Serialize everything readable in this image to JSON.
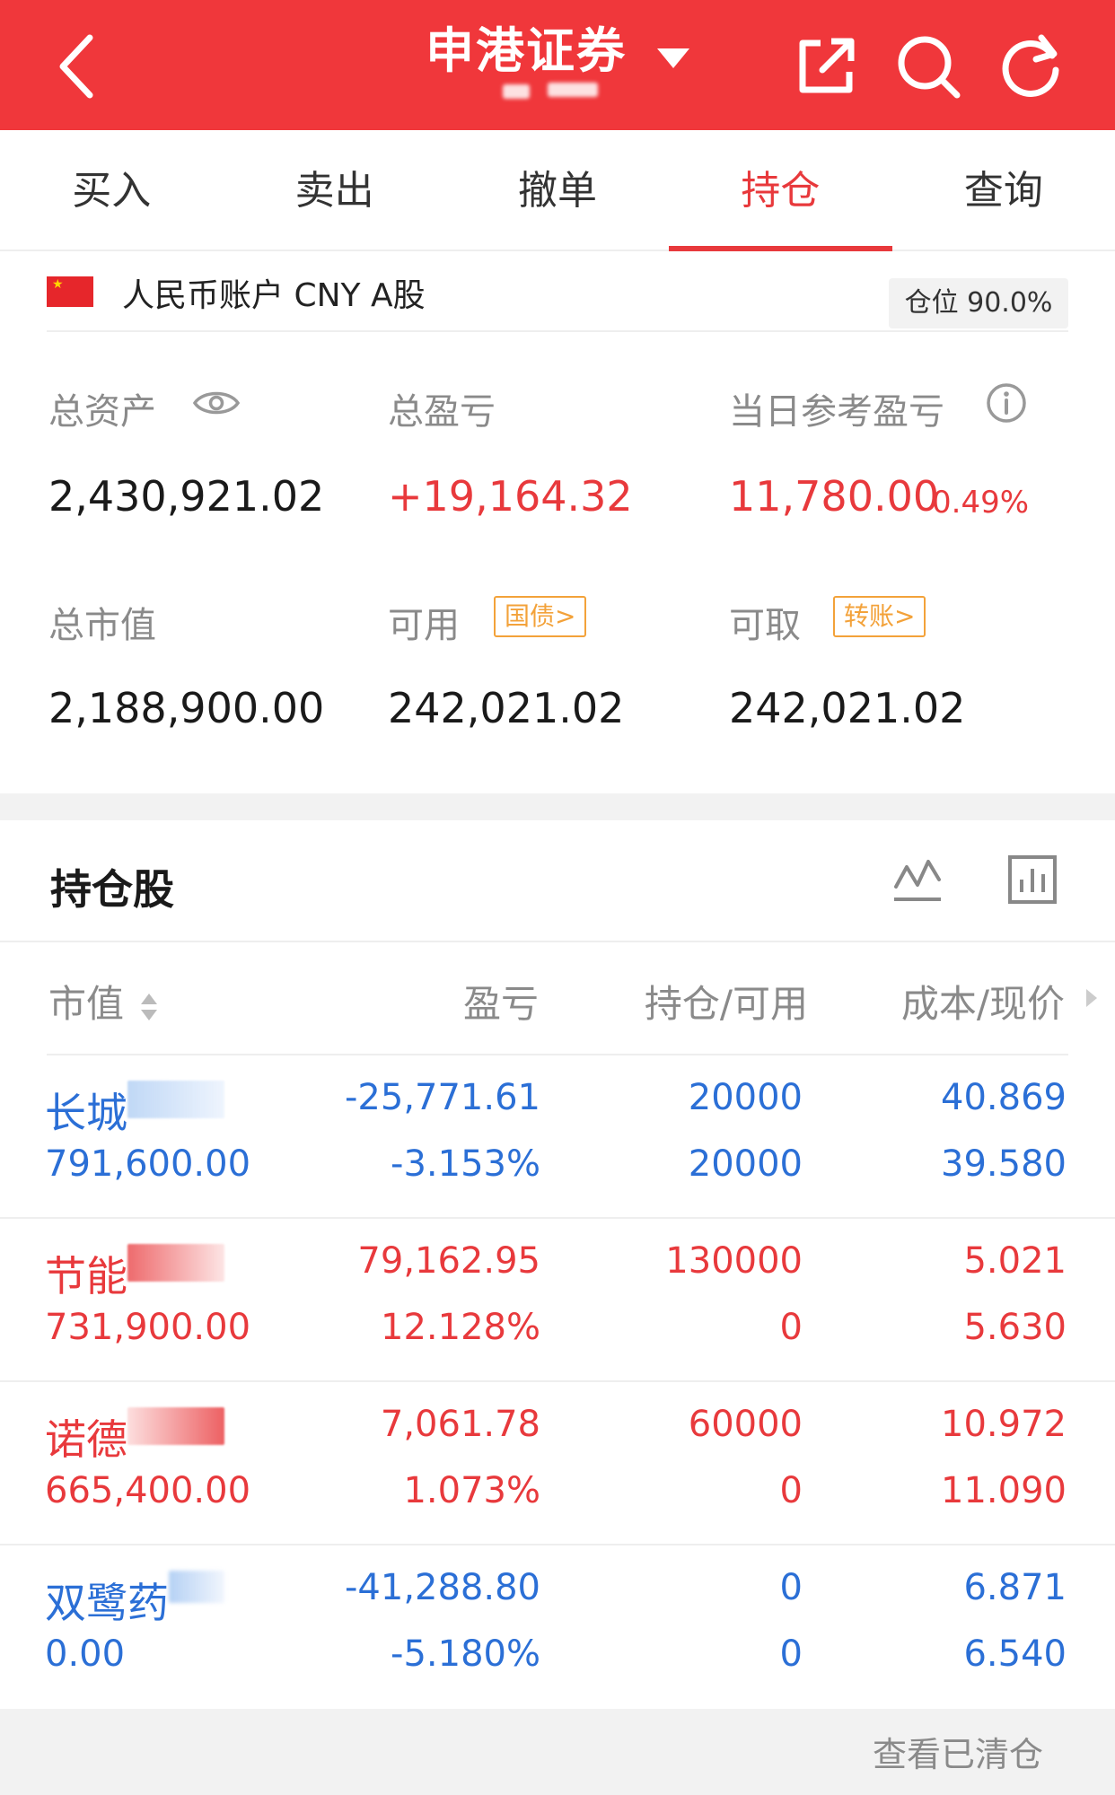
{
  "header": {
    "title": "申港证券",
    "back_icon": "chevron-left-icon",
    "share_icon": "share-icon",
    "search_icon": "search-icon",
    "refresh_icon": "refresh-icon",
    "color": "#f0373b"
  },
  "tabs": [
    {
      "label": "买入",
      "active": false
    },
    {
      "label": "卖出",
      "active": false
    },
    {
      "label": "撤单",
      "active": false
    },
    {
      "label": "持仓",
      "active": true
    },
    {
      "label": "查询",
      "active": false
    }
  ],
  "account": {
    "label": "人民币账户 CNY A股",
    "flag_icon": "china-flag-icon",
    "position": "仓位 90.0%"
  },
  "summary": {
    "total_assets_label": "总资产",
    "total_assets": "2,430,921.02",
    "total_pnl_label": "总盈亏",
    "total_pnl": "+19,164.32",
    "daily_pnl_label": "当日参考盈亏",
    "daily_pnl": "11,780.00",
    "daily_pnl_pct": "0.49%",
    "market_value_label": "总市值",
    "market_value": "2,188,900.00",
    "available_label": "可用",
    "available_tag": "国债>",
    "available": "242,021.02",
    "withdrawable_label": "可取",
    "withdrawable_tag": "转账>",
    "withdrawable": "242,021.02"
  },
  "holdings": {
    "title": "持仓股",
    "columns": {
      "market_value": "市值",
      "pnl": "盈亏",
      "position": "持仓/可用",
      "cost_price": "成本/现价"
    },
    "rows": [
      {
        "name": "长城",
        "value": "791,600.00",
        "pnl": "-25,771.61",
        "pnl_pct": "-3.153%",
        "position": "20000",
        "available": "20000",
        "cost": "40.869",
        "price": "39.580",
        "color": "blue"
      },
      {
        "name": "节能",
        "value": "731,900.00",
        "pnl": "79,162.95",
        "pnl_pct": "12.128%",
        "position": "130000",
        "available": "0",
        "cost": "5.021",
        "price": "5.630",
        "color": "red"
      },
      {
        "name": "诺德",
        "value": "665,400.00",
        "pnl": "7,061.78",
        "pnl_pct": "1.073%",
        "position": "60000",
        "available": "0",
        "cost": "10.972",
        "price": "11.090",
        "color": "red"
      },
      {
        "name": "双鹭药",
        "value": "0.00",
        "pnl": "-41,288.80",
        "pnl_pct": "-5.180%",
        "position": "0",
        "available": "0",
        "cost": "6.871",
        "price": "6.540",
        "color": "blue"
      }
    ]
  },
  "footer": {
    "link": "查看已清仓"
  }
}
